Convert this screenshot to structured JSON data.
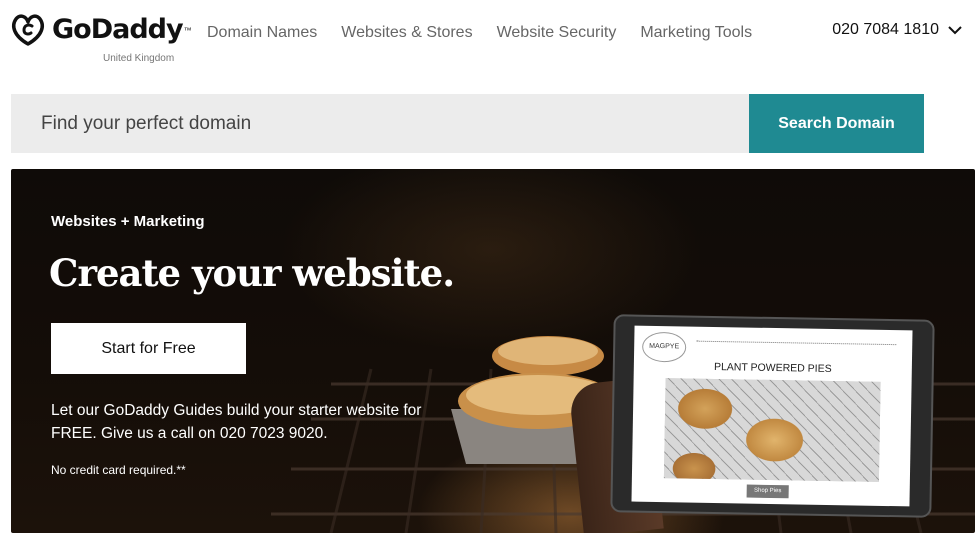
{
  "header": {
    "brand": {
      "name": "GoDaddy",
      "trademark": "™",
      "region": "United Kingdom"
    },
    "nav": [
      {
        "label": "Domain Names"
      },
      {
        "label": "Websites & Stores"
      },
      {
        "label": "Website Security"
      },
      {
        "label": "Marketing Tools"
      }
    ],
    "phone": {
      "number": "020 7084 1810",
      "icon": "chevron-down-icon"
    }
  },
  "search": {
    "placeholder": "Find your perfect domain",
    "value": "",
    "button_label": "Search Domain",
    "button_color": "#1f8a92"
  },
  "hero": {
    "eyebrow": "Websites + Marketing",
    "title": "Create your website.",
    "cta_label": "Start for Free",
    "body": "Let our GoDaddy Guides build your starter website for FREE. Give us a call on 020 7023 9020.",
    "note": "No credit card required.**",
    "tablet": {
      "site_logo": "MAGPYE",
      "heading": "PLANT POWERED PIES",
      "button_label": "Shop Pies"
    }
  }
}
